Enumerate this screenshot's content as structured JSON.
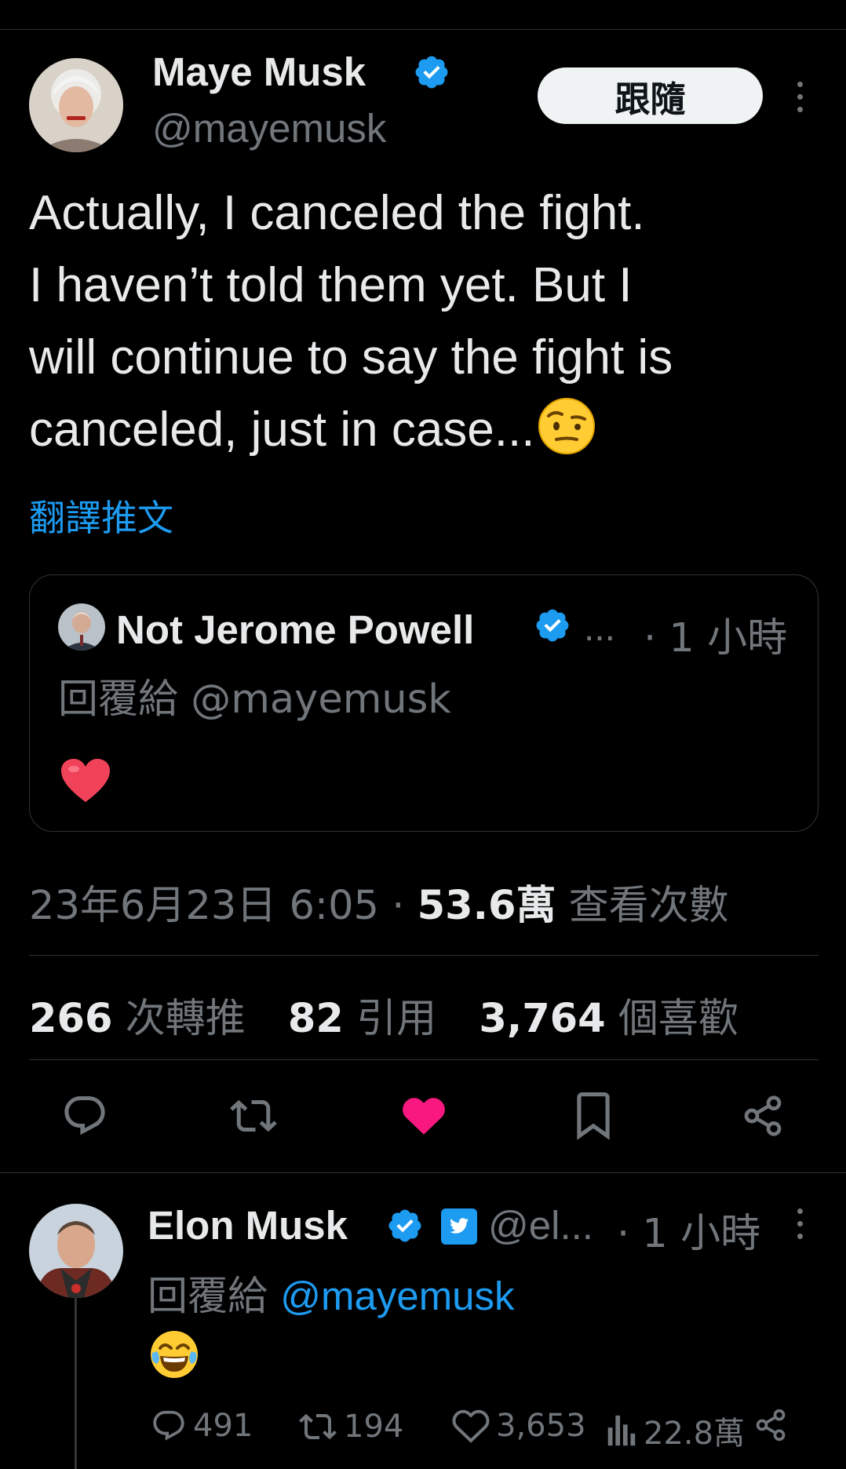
{
  "tweet": {
    "author_name": "Maye Musk",
    "author_handle": "@mayemusk",
    "follow_label": "跟隨",
    "text_lines": [
      "Actually, I canceled the fight.",
      "I haven’t told them yet. But I",
      "will continue to say the fight is",
      "canceled, just in case..."
    ],
    "text_emoji": "face-with-raised-eyebrow",
    "translate_label": "翻譯推文",
    "quote": {
      "name": "Not Jerome Powell",
      "ellipsis": "...",
      "time": "· 1 小時",
      "reply_to": "回覆給 @mayemusk",
      "emoji": "red-heart"
    },
    "date": "23年6月23日 6:05 · ",
    "views_count": "53.6萬",
    "views_label": " 查看次數",
    "stats": {
      "retweets_count": "266",
      "retweets_label": " 次轉推",
      "quotes_count": "82",
      "quotes_label": " 引用",
      "likes_count": "3,764",
      "likes_label": " 個喜歡"
    },
    "liked": true
  },
  "reply": {
    "name": "Elon Musk",
    "handle": "@el...",
    "time": "· 1 小時",
    "reply_prefix": "回覆給 ",
    "reply_mention": "@mayemusk",
    "emoji": "face-with-tears-of-joy",
    "actions": {
      "replies": "491",
      "retweets": "194",
      "likes": "3,653",
      "views": "22.8萬"
    }
  },
  "colors": {
    "background": "#000000",
    "text": "#e7e9ea",
    "muted": "#71767b",
    "link": "#1d9bf0",
    "like": "#f91880",
    "verified": "#1d9bf0",
    "divider": "#2f3336"
  },
  "icons": [
    "verified-badge-icon",
    "more-options-icon",
    "reply-icon",
    "retweet-icon",
    "like-icon",
    "bookmark-icon",
    "share-icon",
    "views-icon",
    "twitter-bird-icon"
  ]
}
